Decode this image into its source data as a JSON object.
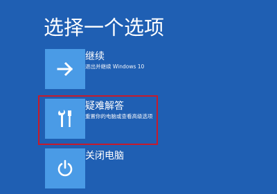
{
  "screen": {
    "title": "选择一个选项"
  },
  "options": [
    {
      "label": "继续",
      "description": "退出并继续 Windows 10",
      "icon": "arrow-right-icon"
    },
    {
      "label": "疑难解答",
      "description": "重置你的电脑或查看高级选项",
      "icon": "tools-icon"
    },
    {
      "label": "关闭电脑",
      "description": "",
      "icon": "power-icon"
    }
  ],
  "colors": {
    "background": "#1f5fb3",
    "tile": "#4a9be6",
    "highlight": "#c81a2a",
    "text": "#ffffff"
  }
}
